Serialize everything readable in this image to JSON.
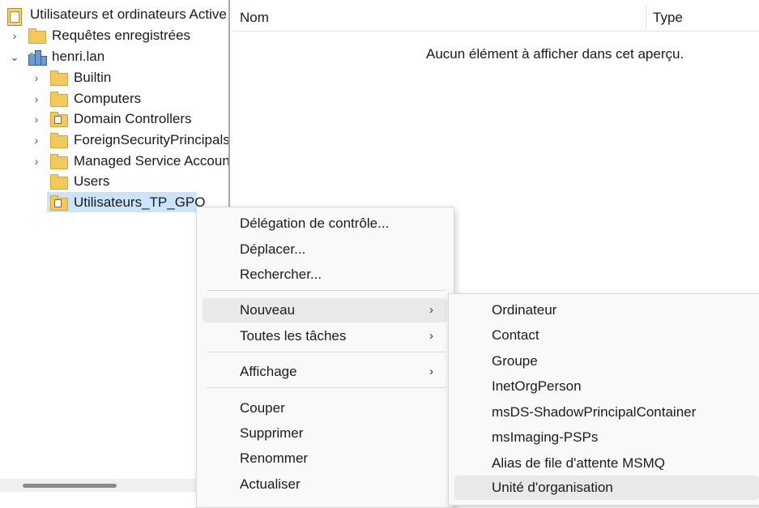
{
  "tree": {
    "root": {
      "label": "Utilisateurs et ordinateurs Active",
      "icon": "aduc-root-icon"
    },
    "items": [
      {
        "label": "Requêtes enregistrées",
        "icon": "folder-icon",
        "chevron": "›"
      },
      {
        "label": "henri.lan",
        "icon": "domain-icon",
        "chevron": "⌄"
      },
      {
        "label": "Builtin",
        "icon": "folder-icon",
        "chevron": "›"
      },
      {
        "label": "Computers",
        "icon": "folder-icon",
        "chevron": "›"
      },
      {
        "label": "Domain Controllers",
        "icon": "ou-folder-icon",
        "chevron": "›"
      },
      {
        "label": "ForeignSecurityPrincipals",
        "icon": "folder-icon",
        "chevron": "›"
      },
      {
        "label": "Managed Service Accoun",
        "icon": "folder-icon",
        "chevron": "›"
      },
      {
        "label": "Users",
        "icon": "folder-icon"
      },
      {
        "label": "Utilisateurs_TP_GPO",
        "icon": "ou-folder-icon",
        "selected": true
      }
    ]
  },
  "list": {
    "columns": [
      "Nom",
      "Type"
    ],
    "empty_message": "Aucun élément à afficher dans cet aperçu."
  },
  "context_menu": {
    "items": [
      {
        "label": "Délégation de contrôle..."
      },
      {
        "label": "Déplacer..."
      },
      {
        "label": "Rechercher..."
      },
      {
        "label": "Nouveau",
        "submenu": true,
        "highlighted": true
      },
      {
        "label": "Toutes les tâches",
        "submenu": true
      },
      {
        "label": "Affichage",
        "submenu": true
      },
      {
        "label": "Couper"
      },
      {
        "label": "Supprimer"
      },
      {
        "label": "Renommer"
      },
      {
        "label": "Actualiser"
      }
    ],
    "arrow": "›"
  },
  "submenu": {
    "items": [
      {
        "label": "Ordinateur"
      },
      {
        "label": "Contact"
      },
      {
        "label": "Groupe"
      },
      {
        "label": "InetOrgPerson"
      },
      {
        "label": "msDS-ShadowPrincipalContainer"
      },
      {
        "label": "msImaging-PSPs"
      },
      {
        "label": "Alias de file d'attente MSMQ"
      },
      {
        "label": "Unité d'organisation",
        "highlighted": true
      }
    ]
  },
  "colors": {
    "selection": "#cce4f7",
    "menu_bg": "#f9f9f9",
    "folder": "#f3c95a"
  }
}
